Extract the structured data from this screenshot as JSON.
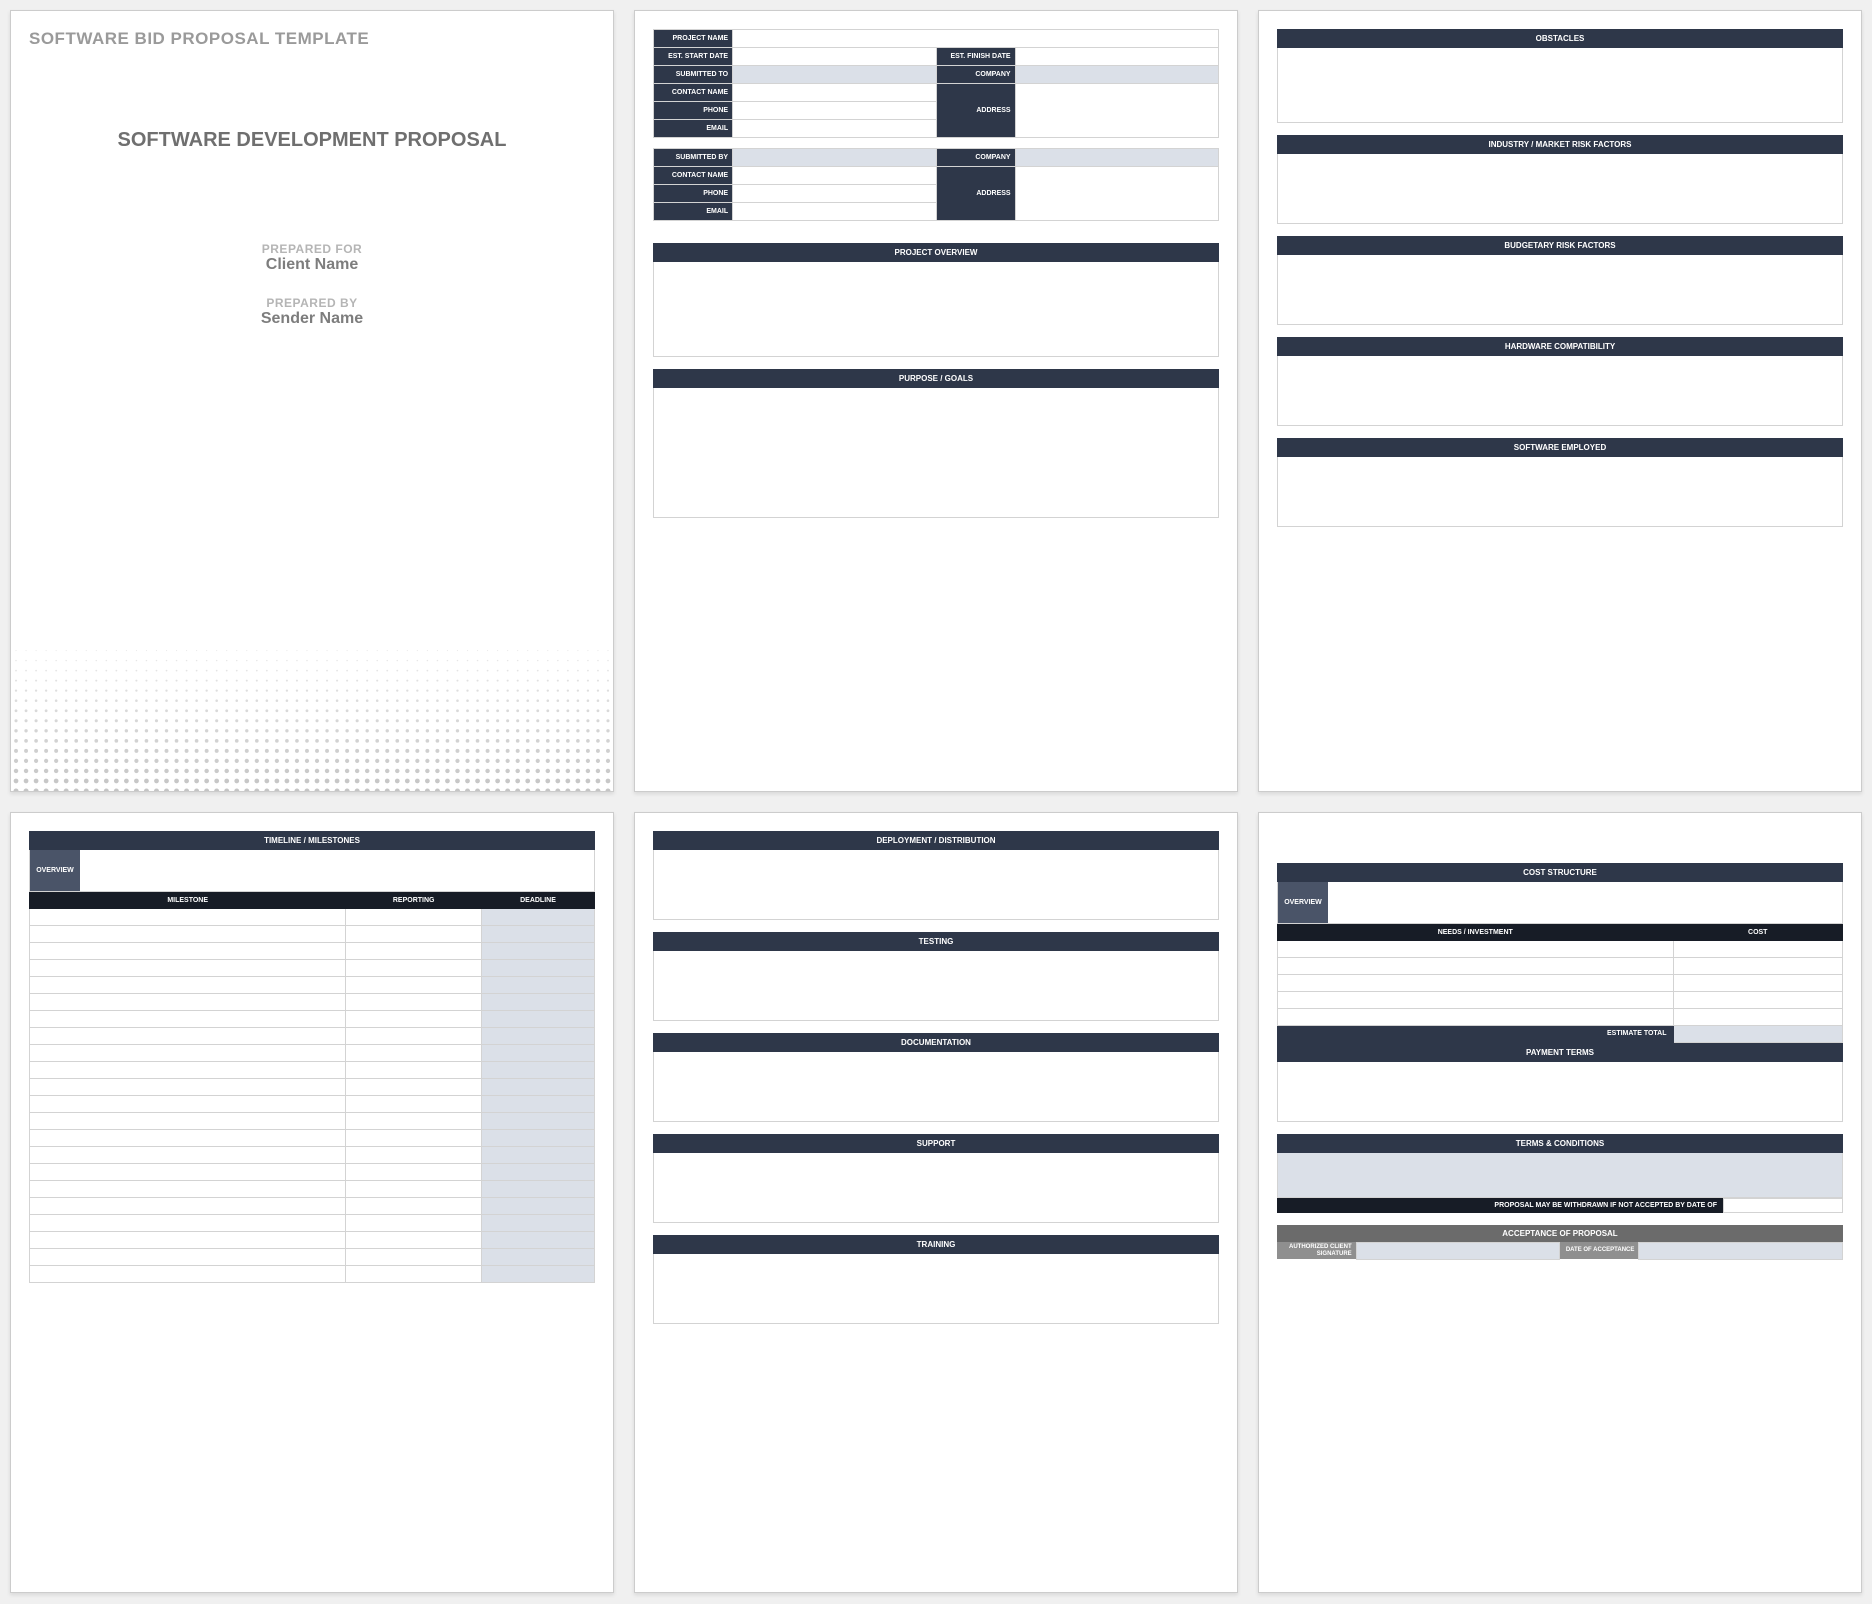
{
  "cover": {
    "template_name": "SOFTWARE BID PROPOSAL TEMPLATE",
    "heading": "SOFTWARE DEVELOPMENT PROPOSAL",
    "prepared_for_label": "PREPARED FOR",
    "prepared_for_value": "Client Name",
    "prepared_by_label": "PREPARED BY",
    "prepared_by_value": "Sender Name"
  },
  "page2": {
    "fields1": {
      "project_name": "PROJECT NAME",
      "est_start": "EST. START DATE",
      "est_finish": "EST. FINISH DATE",
      "submitted_to": "SUBMITTED TO",
      "company": "COMPANY",
      "contact_name": "CONTACT NAME",
      "phone": "PHONE",
      "address": "ADDRESS",
      "email": "EMAIL"
    },
    "fields2": {
      "submitted_by": "SUBMITTED BY",
      "company": "COMPANY",
      "contact_name": "CONTACT NAME",
      "phone": "PHONE",
      "address": "ADDRESS",
      "email": "EMAIL"
    },
    "overview": "PROJECT OVERVIEW",
    "purpose": "PURPOSE / GOALS"
  },
  "page3": {
    "obstacles": "OBSTACLES",
    "industry_risk": "INDUSTRY / MARKET RISK FACTORS",
    "budget_risk": "BUDGETARY RISK FACTORS",
    "hardware": "HARDWARE COMPATIBILITY",
    "software": "SOFTWARE EMPLOYED"
  },
  "page4": {
    "title": "TIMELINE / MILESTONES",
    "overview": "OVERVIEW",
    "col_milestone": "MILESTONE",
    "col_reporting": "REPORTING",
    "col_deadline": "DEADLINE",
    "rows": 22
  },
  "page5": {
    "deployment": "DEPLOYMENT / DISTRIBUTION",
    "testing": "TESTING",
    "documentation": "DOCUMENTATION",
    "support": "SUPPORT",
    "training": "TRAINING"
  },
  "page6": {
    "cost_structure": "COST STRUCTURE",
    "overview": "OVERVIEW",
    "col_needs": "NEEDS / INVESTMENT",
    "col_cost": "COST",
    "rows": 5,
    "estimate_total": "ESTIMATE TOTAL",
    "payment_terms": "PAYMENT TERMS",
    "terms_conditions": "TERMS & CONDITIONS",
    "withdraw": "PROPOSAL MAY BE WITHDRAWN IF NOT ACCEPTED BY DATE OF",
    "acceptance": "ACCEPTANCE OF PROPOSAL",
    "sig_client": "AUTHORIZED CLIENT SIGNATURE",
    "sig_date": "DATE OF ACCEPTANCE"
  }
}
